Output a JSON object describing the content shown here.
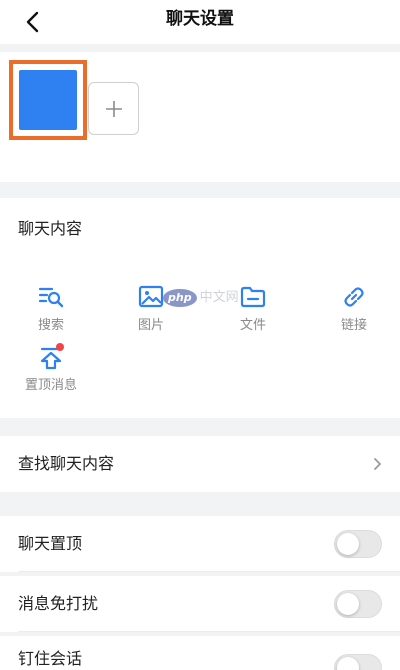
{
  "header": {
    "title": "聊天设置"
  },
  "chat_content": {
    "title": "聊天内容",
    "features": [
      {
        "label": "搜索",
        "icon": "search-list-icon"
      },
      {
        "label": "图片",
        "icon": "image-icon"
      },
      {
        "label": "文件",
        "icon": "folder-icon"
      },
      {
        "label": "链接",
        "icon": "link-icon"
      },
      {
        "label": "置顶消息",
        "icon": "pin-top-icon",
        "badge": true
      }
    ]
  },
  "watermark": {
    "logo": "php",
    "text": "中文网"
  },
  "find_row": {
    "label": "查找聊天内容"
  },
  "settings": [
    {
      "label": "聊天置顶",
      "on": false
    },
    {
      "label": "消息免打扰",
      "on": false
    },
    {
      "label": "钉住会话",
      "on": false
    }
  ],
  "colors": {
    "accent": "#2f80f0",
    "highlight_border": "#ea6d2c",
    "badge": "#f04646",
    "background": "#f2f3f5"
  }
}
